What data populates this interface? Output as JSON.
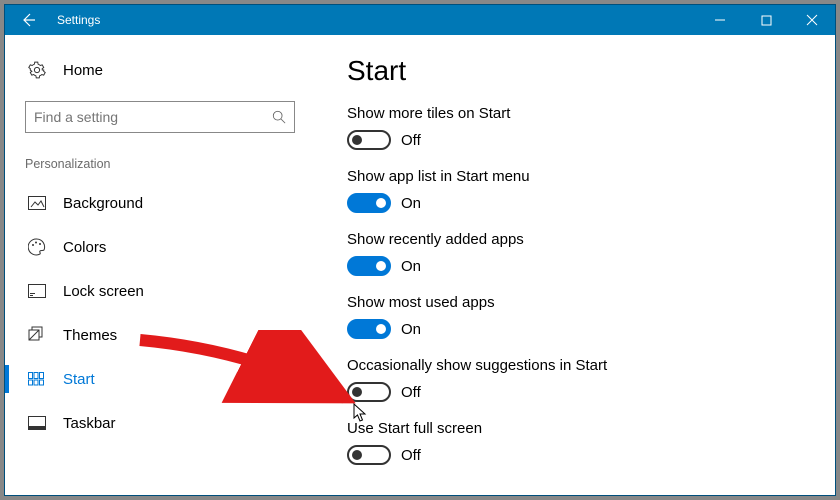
{
  "window": {
    "title": "Settings"
  },
  "sidebar": {
    "home_label": "Home",
    "search_placeholder": "Find a setting",
    "group_label": "Personalization",
    "items": [
      {
        "label": "Background"
      },
      {
        "label": "Colors"
      },
      {
        "label": "Lock screen"
      },
      {
        "label": "Themes"
      },
      {
        "label": "Start"
      },
      {
        "label": "Taskbar"
      }
    ]
  },
  "main": {
    "heading": "Start",
    "settings": [
      {
        "label": "Show more tiles on Start",
        "on": false,
        "state": "Off"
      },
      {
        "label": "Show app list in Start menu",
        "on": true,
        "state": "On"
      },
      {
        "label": "Show recently added apps",
        "on": true,
        "state": "On"
      },
      {
        "label": "Show most used apps",
        "on": true,
        "state": "On"
      },
      {
        "label": "Occasionally show suggestions in Start",
        "on": false,
        "state": "Off"
      },
      {
        "label": "Use Start full screen",
        "on": false,
        "state": "Off"
      }
    ]
  }
}
